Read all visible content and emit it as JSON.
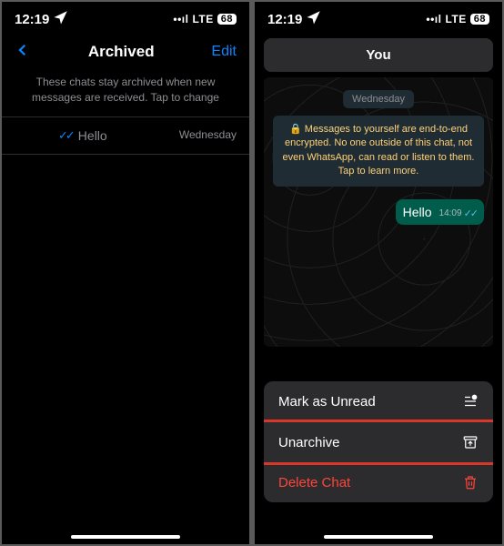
{
  "statusBar": {
    "time": "12:19",
    "network": "LTE",
    "battery": "68"
  },
  "left": {
    "title": "Archived",
    "edit": "Edit",
    "info": "These chats stay archived when new messages are received. Tap to change",
    "chat": {
      "preview": "Hello",
      "day": "Wednesday"
    }
  },
  "right": {
    "contact": "You",
    "day": "Wednesday",
    "encryption": "Messages to yourself are end-to-end encrypted. No one outside of this chat, not even WhatsApp, can read or listen to them. Tap to learn more.",
    "bubble": {
      "text": "Hello",
      "time": "14:09"
    },
    "actions": {
      "unread": "Mark as Unread",
      "unarchive": "Unarchive",
      "delete": "Delete Chat"
    }
  }
}
